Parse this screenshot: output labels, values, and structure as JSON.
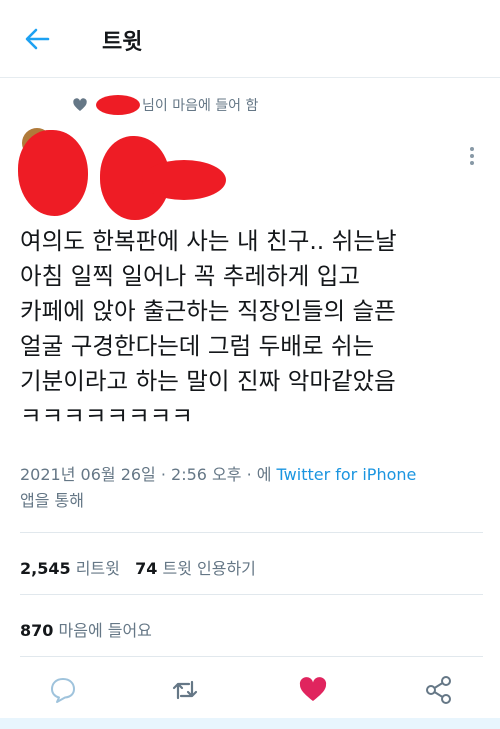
{
  "header": {
    "title": "트윗"
  },
  "social_context": {
    "text": "님이 마음에 들어 함"
  },
  "tweet": {
    "lines": [
      "여의도 한복판에 사는 내 친구.. 쉬는날",
      "아침 일찍 일어나 꼭 추레하게 입고",
      "카페에 앉아 출근하는 직장인들의 슬픈",
      "얼굴 구경한다는데 그럼 두배로 쉬는",
      "기분이라고 하는 말이 진짜 악마같았음",
      "ㅋㅋㅋㅋㅋㅋㅋㅋ"
    ],
    "timestamp": "2021년 06월 26일 · 2:56 오후 · 에 ",
    "source": "Twitter for iPhone",
    "source_suffix": "앱을 통해"
  },
  "stats": {
    "retweets_count": "2,545",
    "retweets_label": "리트윗",
    "quotes_count": "74",
    "quotes_label": "트윗 인용하기",
    "likes_count": "870",
    "likes_label": "마음에 들어요"
  },
  "colors": {
    "accent": "#1da1f2",
    "like_red": "#e0245e",
    "redaction": "#ee1c25",
    "secondary_text": "#657786"
  }
}
